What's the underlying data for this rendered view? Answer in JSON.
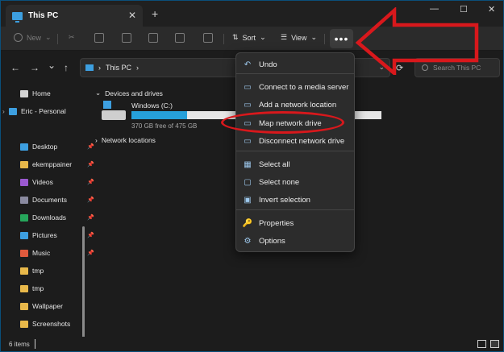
{
  "window": {
    "tab_title": "This PC",
    "new_tab": "+",
    "tab_close": "✕",
    "controls": [
      "—",
      "☐",
      "✕"
    ]
  },
  "toolbar": {
    "new_label": "New",
    "sort_label": "Sort",
    "view_label": "View",
    "more_label": "•••"
  },
  "nav": {
    "back": "←",
    "forward": "→",
    "recent": "⌄",
    "up": "↑",
    "breadcrumb": "This PC",
    "breadcrumb_sep": "›",
    "search_placeholder": "Search This PC"
  },
  "sidebar": {
    "items": [
      {
        "label": "Home",
        "icon": "home-icon",
        "color": "#d4d4d4"
      },
      {
        "label": "Eric - Personal",
        "icon": "onedrive-icon",
        "color": "#3d9fe0"
      },
      {
        "label": "Desktop",
        "icon": "desktop-icon",
        "color": "#3d9fe0",
        "pinned": true
      },
      {
        "label": "ekemppainer",
        "icon": "folder-icon",
        "color": "#e8b84a",
        "pinned": true
      },
      {
        "label": "Videos",
        "icon": "videos-icon",
        "color": "#9b59d0",
        "pinned": true
      },
      {
        "label": "Documents",
        "icon": "documents-icon",
        "color": "#8a8aa0",
        "pinned": true
      },
      {
        "label": "Downloads",
        "icon": "downloads-icon",
        "color": "#26a65b",
        "pinned": true
      },
      {
        "label": "Pictures",
        "icon": "pictures-icon",
        "color": "#3d9fe0",
        "pinned": true
      },
      {
        "label": "Music",
        "icon": "music-icon",
        "color": "#e05a3d",
        "pinned": true
      },
      {
        "label": "tmp",
        "icon": "folder-icon",
        "color": "#e8b84a"
      },
      {
        "label": "tmp",
        "icon": "folder-icon",
        "color": "#e8b84a"
      },
      {
        "label": "Wallpaper",
        "icon": "folder-icon",
        "color": "#e8b84a"
      },
      {
        "label": "Screenshots",
        "icon": "folder-icon",
        "color": "#e8b84a"
      }
    ],
    "pin_glyph": "📌"
  },
  "main": {
    "devices_header": "Devices and drives",
    "network_header": "Network locations",
    "drive": {
      "name": "Windows (C:)",
      "free_text": "370 GB free of 475 GB",
      "used_fraction": 0.221
    }
  },
  "menu": {
    "items": [
      {
        "label": "Undo",
        "icon": "undo-icon",
        "glyph": "↶"
      },
      {
        "label": "Connect to a media server",
        "icon": "media-server-icon",
        "glyph": "▭"
      },
      {
        "label": "Add a network location",
        "icon": "network-location-icon",
        "glyph": "▭"
      },
      {
        "label": "Map network drive",
        "icon": "map-drive-icon",
        "glyph": "▭"
      },
      {
        "label": "Disconnect network drive",
        "icon": "disconnect-drive-icon",
        "glyph": "▭"
      },
      {
        "label": "Select all",
        "icon": "select-all-icon",
        "glyph": "▦"
      },
      {
        "label": "Select none",
        "icon": "select-none-icon",
        "glyph": "▢"
      },
      {
        "label": "Invert selection",
        "icon": "invert-selection-icon",
        "glyph": "▣"
      },
      {
        "label": "Properties",
        "icon": "properties-icon",
        "glyph": "🔑"
      },
      {
        "label": "Options",
        "icon": "options-icon",
        "glyph": "⚙"
      }
    ]
  },
  "status": {
    "items_count": "6 items"
  },
  "colors": {
    "accent": "#26a0da",
    "annotation_red": "#d8181c",
    "background": "#1c1c1c"
  }
}
